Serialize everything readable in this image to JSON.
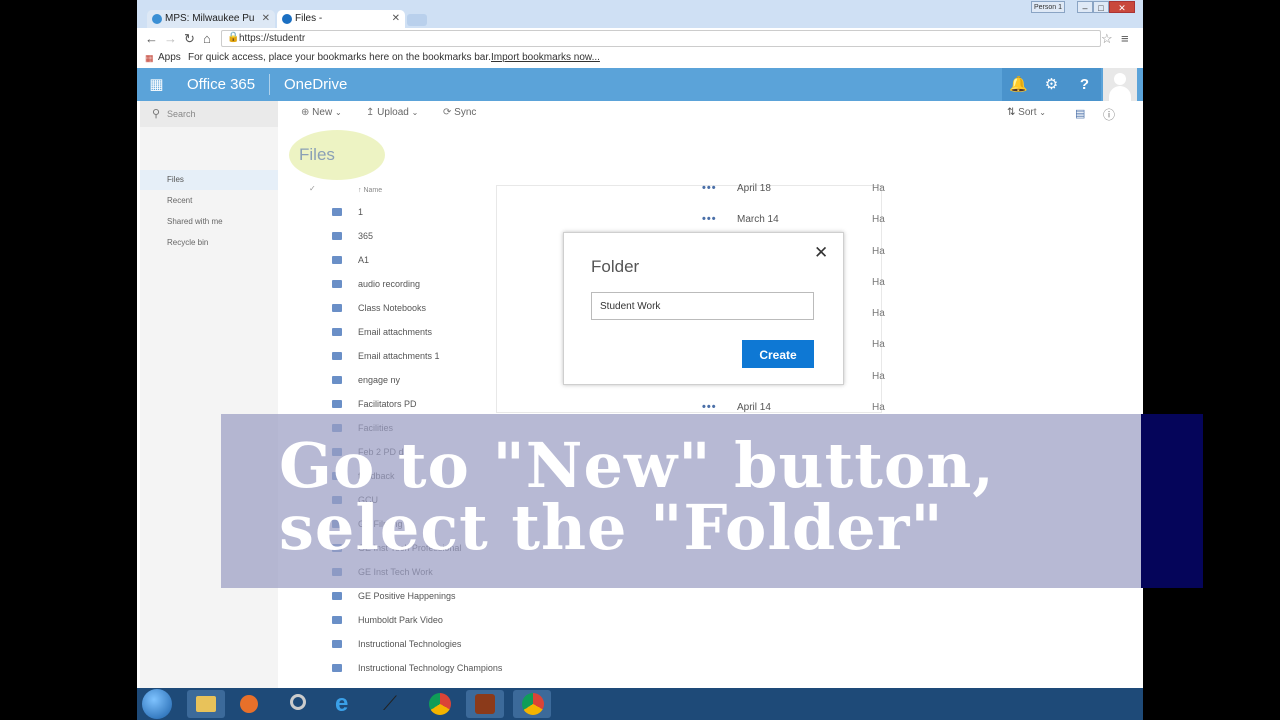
{
  "browser": {
    "tabs": [
      {
        "title": "MPS: Milwaukee Pu"
      },
      {
        "title": "Files -"
      }
    ],
    "profile": "Person 1",
    "url": "https://studentr",
    "bookmarks_apps": "Apps",
    "bookmarks_text": "For quick access, place your bookmarks here on the bookmarks bar.",
    "bookmarks_link": "Import bookmarks now..."
  },
  "header": {
    "app": "Office 365",
    "service": "OneDrive"
  },
  "commands": {
    "search_placeholder": "Search",
    "new": "New",
    "upload": "Upload",
    "sync": "Sync",
    "sort": "Sort"
  },
  "nav": {
    "items": [
      {
        "label": "Files"
      },
      {
        "label": "Recent"
      },
      {
        "label": "Shared with me"
      },
      {
        "label": "Recycle bin"
      }
    ]
  },
  "main": {
    "title": "Files",
    "name_header": "Name",
    "files": [
      "1",
      "365",
      "A1",
      "audio recording",
      "Class Notebooks",
      "Email attachments",
      "Email attachments 1",
      "engage ny",
      "Facilitators PD",
      "Facilities",
      "Feb 2 PD day",
      "feedback",
      "GCU",
      "GE Filming",
      "GE Inst Tech Professional",
      "GE Inst Tech Work",
      "GE Positive Happenings",
      "Humboldt Park Video",
      "Instructional Technologies",
      "Instructional Technology Champions"
    ],
    "dates": [
      "April 18",
      "March 14",
      "April 14"
    ],
    "modified_by_prefix": "Ha"
  },
  "dialog": {
    "title": "Folder",
    "input_value": "Student Work",
    "create_label": "Create"
  },
  "overlay": {
    "line1": "Go to \"New\" button,",
    "line2": "select the \"Folder\""
  }
}
